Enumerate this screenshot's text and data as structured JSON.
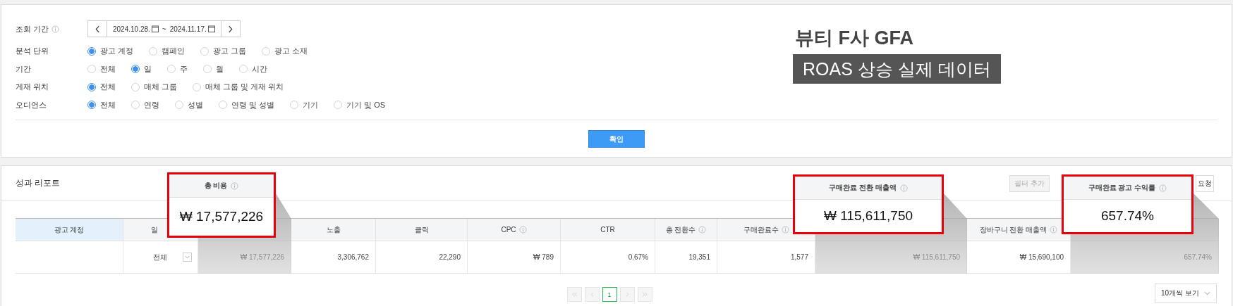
{
  "filters": {
    "period": {
      "label": "조회 기간",
      "info": true,
      "start": "2024.10.28.",
      "separator": "~",
      "end": "2024.11.17."
    },
    "radio_groups": [
      {
        "label": "분석 단위",
        "options": [
          {
            "label": "광고 계정",
            "selected": true
          },
          {
            "label": "캠페인",
            "selected": false
          },
          {
            "label": "광고 그룹",
            "selected": false
          },
          {
            "label": "광고 소재",
            "selected": false
          }
        ]
      },
      {
        "label": "기간",
        "options": [
          {
            "label": "전체",
            "selected": false
          },
          {
            "label": "일",
            "selected": true
          },
          {
            "label": "주",
            "selected": false
          },
          {
            "label": "월",
            "selected": false
          },
          {
            "label": "시간",
            "selected": false
          }
        ]
      },
      {
        "label": "게재 위치",
        "options": [
          {
            "label": "전체",
            "selected": true
          },
          {
            "label": "매체 그룹",
            "selected": false
          },
          {
            "label": "매체 그룹 및 게재 위치",
            "selected": false
          }
        ]
      },
      {
        "label": "오디언스",
        "options": [
          {
            "label": "전체",
            "selected": true
          },
          {
            "label": "연령",
            "selected": false
          },
          {
            "label": "성별",
            "selected": false
          },
          {
            "label": "연령 및 성별",
            "selected": false
          },
          {
            "label": "기기",
            "selected": false
          },
          {
            "label": "기기 및 OS",
            "selected": false
          }
        ]
      }
    ],
    "confirm_button": "확인"
  },
  "overlay": {
    "title": "뷰티 F사 GFA",
    "badge": "ROAS 상승 실제 데이터"
  },
  "report": {
    "title": "성과 리포트",
    "buttons": [
      {
        "label": "필터 추가",
        "disabled": true
      },
      {
        "label": "요청",
        "disabled": false
      }
    ],
    "table": {
      "columns": [
        {
          "label": "광고 계정",
          "info": false,
          "pinned": true
        },
        {
          "label": "일",
          "info": false,
          "pinned": false
        },
        {
          "callout": {
            "title": "총 비용",
            "info": true,
            "value": "₩ 17,577,226"
          }
        },
        {
          "label": "노출",
          "info": false,
          "pinned": false
        },
        {
          "label": "클릭",
          "info": false,
          "pinned": false
        },
        {
          "label": "CPC",
          "info": true,
          "pinned": false
        },
        {
          "label": "CTR",
          "info": false,
          "pinned": false
        },
        {
          "label": "총 전환수",
          "info": true,
          "pinned": false
        },
        {
          "label": "구매완료수",
          "info": true,
          "pinned": false
        },
        {
          "callout": {
            "title": "구매완료 전환 매출액",
            "info": true,
            "value": "₩ 115,611,750"
          }
        },
        {
          "label": "장바구니 전환 매출액",
          "info": true,
          "pinned": false
        },
        {
          "callout": {
            "title": "구매완료 광고 수익률",
            "info": true,
            "value": "657.74%"
          }
        }
      ],
      "rows": [
        {
          "day_select": "전체",
          "values": [
            "₩ 17,577,226",
            "3,306,762",
            "22,290",
            "₩ 789",
            "0.67%",
            "19,351",
            "1,577",
            "₩ 115,611,750",
            "₩ 15,690,100",
            "657.74%"
          ]
        }
      ]
    },
    "pagination": {
      "pages": [
        {
          "label": "1",
          "selected": true
        }
      ]
    },
    "page_size": "10개씩 보기"
  }
}
